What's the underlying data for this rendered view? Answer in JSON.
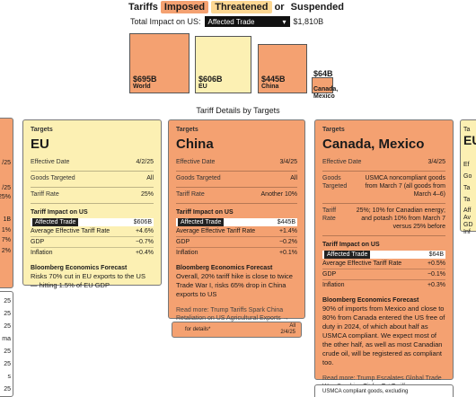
{
  "legend": {
    "tariffs": "Tariffs",
    "imposed": "Imposed",
    "threatened": "Threatened",
    "or": "or",
    "suspended": "Suspended"
  },
  "total": {
    "label": "Total Impact on US:",
    "affected": "Affected Trade",
    "value": "$1,810B"
  },
  "boxes": [
    {
      "value": "$695B",
      "label": "World"
    },
    {
      "value": "$606B",
      "label": "EU"
    },
    {
      "value": "$445B",
      "label": "China"
    },
    {
      "value": "$64B",
      "label": "Canada, Mexico"
    }
  ],
  "section_title": "Tariff Details by Targets",
  "cards": {
    "eu": {
      "targets": "Targets",
      "country": "EU",
      "effective_date_k": "Effective Date",
      "effective_date_v": "4/2/25",
      "goods_k": "Goods Targeted",
      "goods_v": "All",
      "rate_k": "Tariff Rate",
      "rate_v": "25%",
      "impact": "Tariff Impact on US",
      "affected_k": "Affected Trade",
      "affected_v": "$606B",
      "avg_k": "Average Effective Tariff Rate",
      "avg_v": "+4.6%",
      "gdp_k": "GDP",
      "gdp_v": "−0.7%",
      "inf_k": "Inflation",
      "inf_v": "+0.4%",
      "fc_title": "Bloomberg Economics Forecast",
      "fc_text": "Risks 70% cut in EU exports to the US — hitting 1.5% of EU GDP"
    },
    "china": {
      "targets": "Targets",
      "country": "China",
      "effective_date_k": "Effective Date",
      "effective_date_v": "3/4/25",
      "goods_k": "Goods Targeted",
      "goods_v": "All",
      "rate_k": "Tariff Rate",
      "rate_v": "Another 10%",
      "impact": "Tariff Impact on US",
      "affected_k": "Affected Trade",
      "affected_v": "$445B",
      "avg_k": "Average Effective Tariff Rate",
      "avg_v": "+1.4%",
      "gdp_k": "GDP",
      "gdp_v": "−0.2%",
      "inf_k": "Inflation",
      "inf_v": "+0.1%",
      "fc_title": "Bloomberg Economics Forecast",
      "fc_text": "Overall, 20% tariff hike is close to twice Trade War I, risks 65% drop in China exports to US",
      "readmore": "Read more: Trump Tariffs Spark China Retaliation on US Agricultural Exports →",
      "below_left": "for details*",
      "below_right_1": "All",
      "below_right_2": "2/4/25"
    },
    "canmex": {
      "targets": "Targets",
      "country": "Canada, Mexico",
      "effective_date_k": "Effective Date",
      "effective_date_v": "3/4/25",
      "goods_k": "Goods Targeted",
      "goods_v": "USMCA noncompliant goods from March 7 (all goods from March 4–6)",
      "rate_k": "Tariff Rate",
      "rate_v": "25%; 10% for Canadian energy; and potash 10% from March 7 versus 25% before",
      "impact": "Tariff Impact on US",
      "affected_k": "Affected Trade",
      "affected_v": "$64B",
      "avg_k": "Average Effective Tariff Rate",
      "avg_v": "+0.5%",
      "gdp_k": "GDP",
      "gdp_v": "−0.1%",
      "inf_k": "Inflation",
      "inf_v": "+0.3%",
      "fc_title": "Bloomberg Economics Forecast",
      "fc_text": "90% of imports from Mexico and close to 80% from Canada entered the US free of duty in 2024, of which about half as USMCA compliant. We expect most of the other half, as well as most Canadian crude oil, will be registered as compliant too.",
      "readmore": "Read more: Trump Escalates Global Trade War, Sparking Tit-for-Tat Tariffs →",
      "below": "USMCA compliant goods, excluding"
    }
  },
  "left_edge": [
    "/25",
    "/25",
    "25%",
    "1B",
    "1%",
    "7%",
    "2%",
    "25",
    "25",
    "25",
    "ma",
    "25",
    "25",
    "s",
    "25"
  ],
  "right_edge": [
    "Ta",
    "EU",
    "Ef",
    "Go",
    "Ta",
    "Ta",
    "Aff",
    "Av",
    "GD",
    "Inf",
    "Bl",
    "Alo"
  ]
}
